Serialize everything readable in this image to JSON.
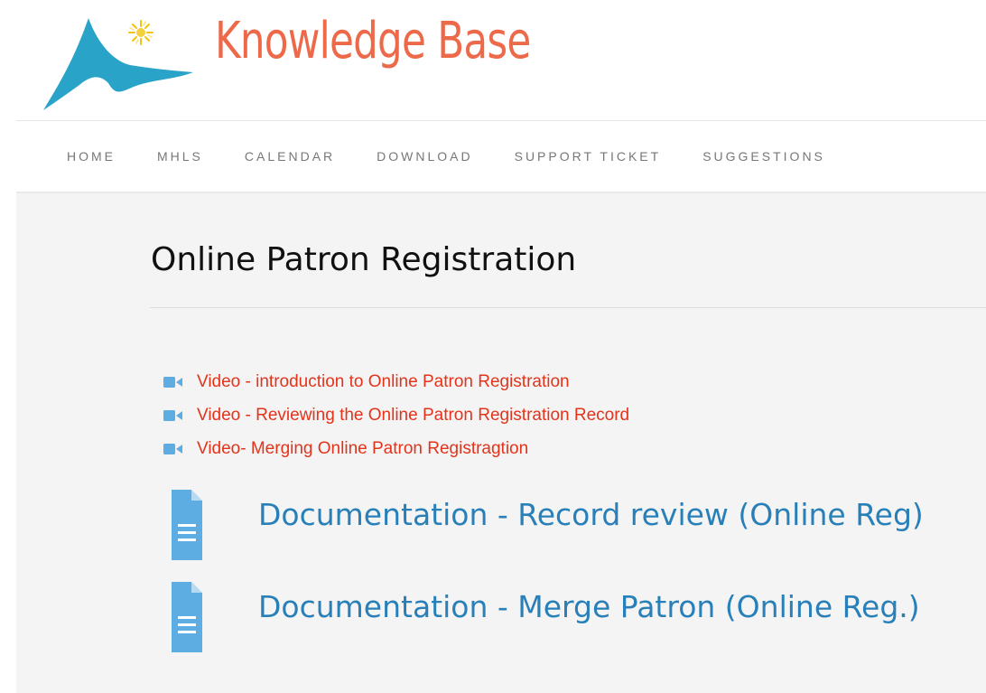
{
  "header": {
    "site_title": "Knowledge Base",
    "logo_icon": "logo-mountain-sun-icon",
    "title_color": "#ec6a49"
  },
  "nav": {
    "items": [
      {
        "label": "HOME"
      },
      {
        "label": "MHLS"
      },
      {
        "label": "CALENDAR"
      },
      {
        "label": "DOWNLOAD"
      },
      {
        "label": "SUPPORT TICKET"
      },
      {
        "label": "SUGGESTIONS"
      }
    ]
  },
  "main": {
    "page_title": "Online Patron Registration",
    "videos": [
      {
        "icon": "video-camera-icon",
        "label": "Video - introduction to Online Patron Registration"
      },
      {
        "icon": "video-camera-icon",
        "label": "Video - Reviewing the Online Patron Registration Record"
      },
      {
        "icon": "video-camera-icon",
        "label": "Video- Merging Online Patron Registragtion"
      }
    ],
    "documents": [
      {
        "icon": "document-icon",
        "label": "Documentation - Record review (Online Reg)"
      },
      {
        "icon": "document-icon",
        "label": "Documentation - Merge Patron (Online Reg.)"
      }
    ]
  },
  "colors": {
    "video_link": "#e4331b",
    "doc_link": "#2980b9",
    "icon_blue": "#5dade2",
    "content_bg": "#f4f4f4"
  }
}
